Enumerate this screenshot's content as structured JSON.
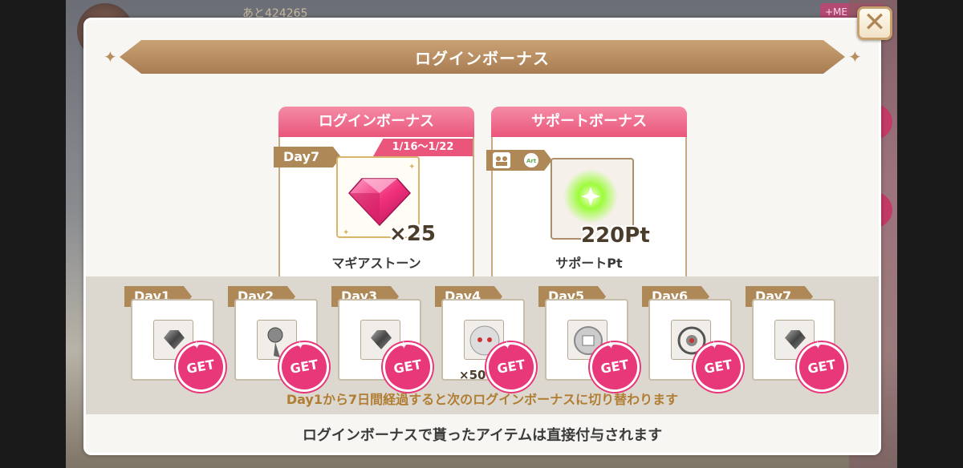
{
  "background": {
    "counter_text": "あと424265",
    "menu_label": "+ME"
  },
  "dialog": {
    "title": "ログインボーナス",
    "close_glyph": "✕"
  },
  "login_card": {
    "title": "ログインボーナス",
    "date_range": "1/16～1/22",
    "day_label": "Day7",
    "item_name": "マギアストーン",
    "quantity": "×25"
  },
  "support_card": {
    "title": "サポートボーナス",
    "item_name": "サポートPt",
    "quantity": "220Pt"
  },
  "days": [
    {
      "label": "Day1",
      "item_icon": "grey-crystal-icon",
      "badge": "GET"
    },
    {
      "label": "Day2",
      "item_icon": "key-orb-icon",
      "badge": "GET"
    },
    {
      "label": "Day3",
      "item_icon": "grey-crystal-icon",
      "badge": "GET"
    },
    {
      "label": "Day4",
      "item_icon": "kyubey-coin-icon",
      "badge": "GET",
      "qty": "×50"
    },
    {
      "label": "Day5",
      "item_icon": "silver-coin-icon",
      "badge": "GET"
    },
    {
      "label": "Day6",
      "item_icon": "silver-emblem-icon",
      "badge": "GET"
    },
    {
      "label": "Day7",
      "item_icon": "grey-crystal-icon",
      "badge": "GET"
    }
  ],
  "notes": {
    "rotation": "Day1から7日間経過すると次のログインボーナスに切り替わります",
    "delivery": "ログインボーナスで貰ったアイテムは直接付与されます"
  },
  "colors": {
    "header_gold": "#a87c52",
    "pink": "#e9557b",
    "get_pink": "#e8387a",
    "note_gold": "#b07d33"
  }
}
